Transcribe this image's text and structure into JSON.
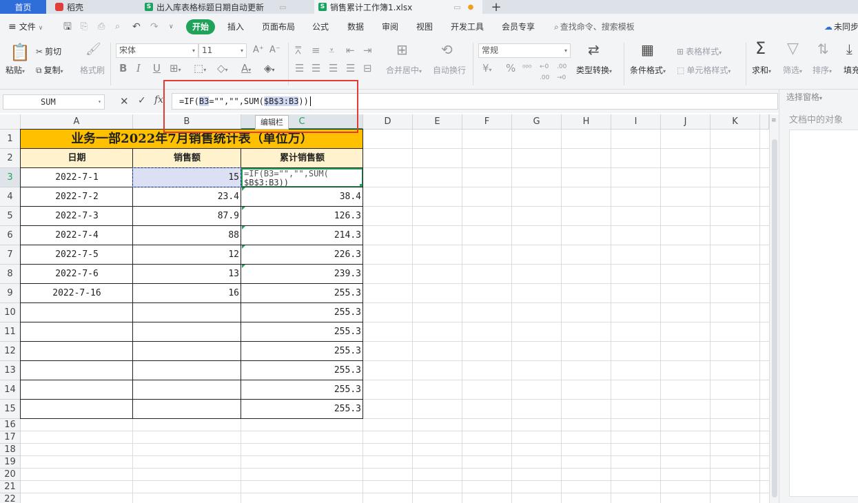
{
  "tabs": {
    "home": "首页",
    "daoke": "稻壳",
    "doc1": "出入库表格标题日期自动更新",
    "doc2": "销售累计工作簿1.xlsx",
    "add": "+"
  },
  "menu": {
    "file": "文件",
    "items": [
      "开始",
      "插入",
      "页面布局",
      "公式",
      "数据",
      "审阅",
      "视图",
      "开发工具",
      "会员专享"
    ],
    "search": "查找命令、搜索模板",
    "sync": "未同步"
  },
  "ribbon": {
    "paste": "粘贴",
    "cut": "剪切",
    "copy": "复制",
    "format_painter": "格式刷",
    "font_name": "宋体",
    "font_size": "11",
    "merge": "合并居中",
    "wrap": "自动换行",
    "number_format": "常规",
    "type_convert": "类型转换",
    "cond_format": "条件格式",
    "table_style": "表格样式",
    "cell_style": "单元格样式",
    "sum": "求和",
    "filter": "筛选",
    "sort": "排序",
    "fill": "填充"
  },
  "formula_bar": {
    "name_box": "SUM",
    "fx": "fx",
    "formula_prefix": "=IF(",
    "formula_ref1": "B3",
    "formula_mid": "=\"\",\"\",SUM(",
    "formula_ref2": "$B$3:B3",
    "formula_suffix": "))",
    "tooltip": "编辑栏"
  },
  "right_panel": {
    "select_pane": "选择窗格",
    "objects": "文档中的对象"
  },
  "sheet": {
    "columns": [
      "A",
      "B",
      "C",
      "D",
      "E",
      "F",
      "G",
      "H",
      "I",
      "J",
      "K"
    ],
    "rows": [
      "1",
      "2",
      "3",
      "4",
      "5",
      "6",
      "7",
      "8",
      "9",
      "10",
      "11",
      "12",
      "13",
      "14",
      "15",
      "16",
      "17",
      "18",
      "19",
      "20",
      "21",
      "22"
    ],
    "title": "业务一部2022年7月销售统计表（单位万）",
    "headers": [
      "日期",
      "销售额",
      "累计销售额"
    ],
    "editing_line1": "=IF(B3=\"\",\"\",SUM(",
    "editing_line2": "$B$3:B3))",
    "data": [
      {
        "date": "2022-7-1",
        "sales": "15",
        "cum": ""
      },
      {
        "date": "2022-7-2",
        "sales": "23.4",
        "cum": "38.4"
      },
      {
        "date": "2022-7-3",
        "sales": "87.9",
        "cum": "126.3"
      },
      {
        "date": "2022-7-4",
        "sales": "88",
        "cum": "214.3"
      },
      {
        "date": "2022-7-5",
        "sales": "12",
        "cum": "226.3"
      },
      {
        "date": "2022-7-6",
        "sales": "13",
        "cum": "239.3"
      },
      {
        "date": "2022-7-16",
        "sales": "16",
        "cum": "255.3"
      },
      {
        "date": "",
        "sales": "",
        "cum": "255.3"
      },
      {
        "date": "",
        "sales": "",
        "cum": "255.3"
      },
      {
        "date": "",
        "sales": "",
        "cum": "255.3"
      },
      {
        "date": "",
        "sales": "",
        "cum": "255.3"
      },
      {
        "date": "",
        "sales": "",
        "cum": "255.3"
      },
      {
        "date": "",
        "sales": "",
        "cum": "255.3"
      }
    ]
  },
  "colors": {
    "title_fill": "#ffc000",
    "header_fill": "#fff2cc",
    "accent_green": "#1fa35a",
    "highlight_red": "#e53935"
  }
}
